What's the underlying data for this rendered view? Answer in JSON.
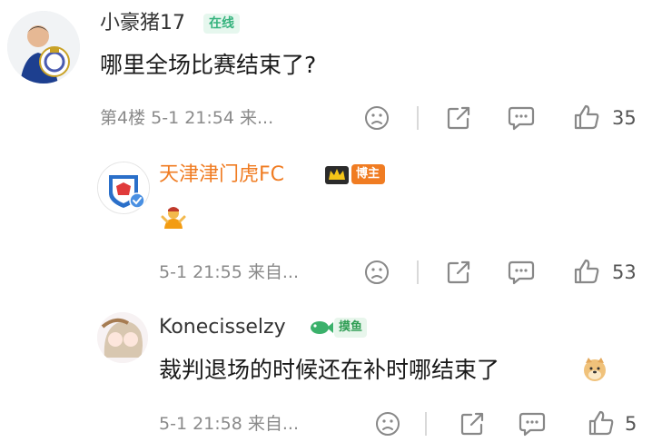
{
  "comments": [
    {
      "username": "小豪猪17",
      "badge": "在线",
      "text": "哪里全场比赛结束了?",
      "meta": "第4楼 5-1 21:54 来...",
      "like_count": "35"
    },
    {
      "username": "天津津门虎FC",
      "badge": "博主",
      "text": "🤷",
      "meta": "5-1 21:55 来自...",
      "like_count": "53"
    },
    {
      "username": "Konecisselzy",
      "badge": "摸鱼",
      "text": "裁判退场的时候还在补时哪结束了",
      "meta": "5-1 21:58 来自...",
      "like_count": "5"
    }
  ],
  "colors": {
    "host_name": "#f07c22",
    "default_name": "#333333",
    "online_badge": "#36b37e",
    "fish_badge": "#2f9d54",
    "verified": "#4a90e2"
  }
}
